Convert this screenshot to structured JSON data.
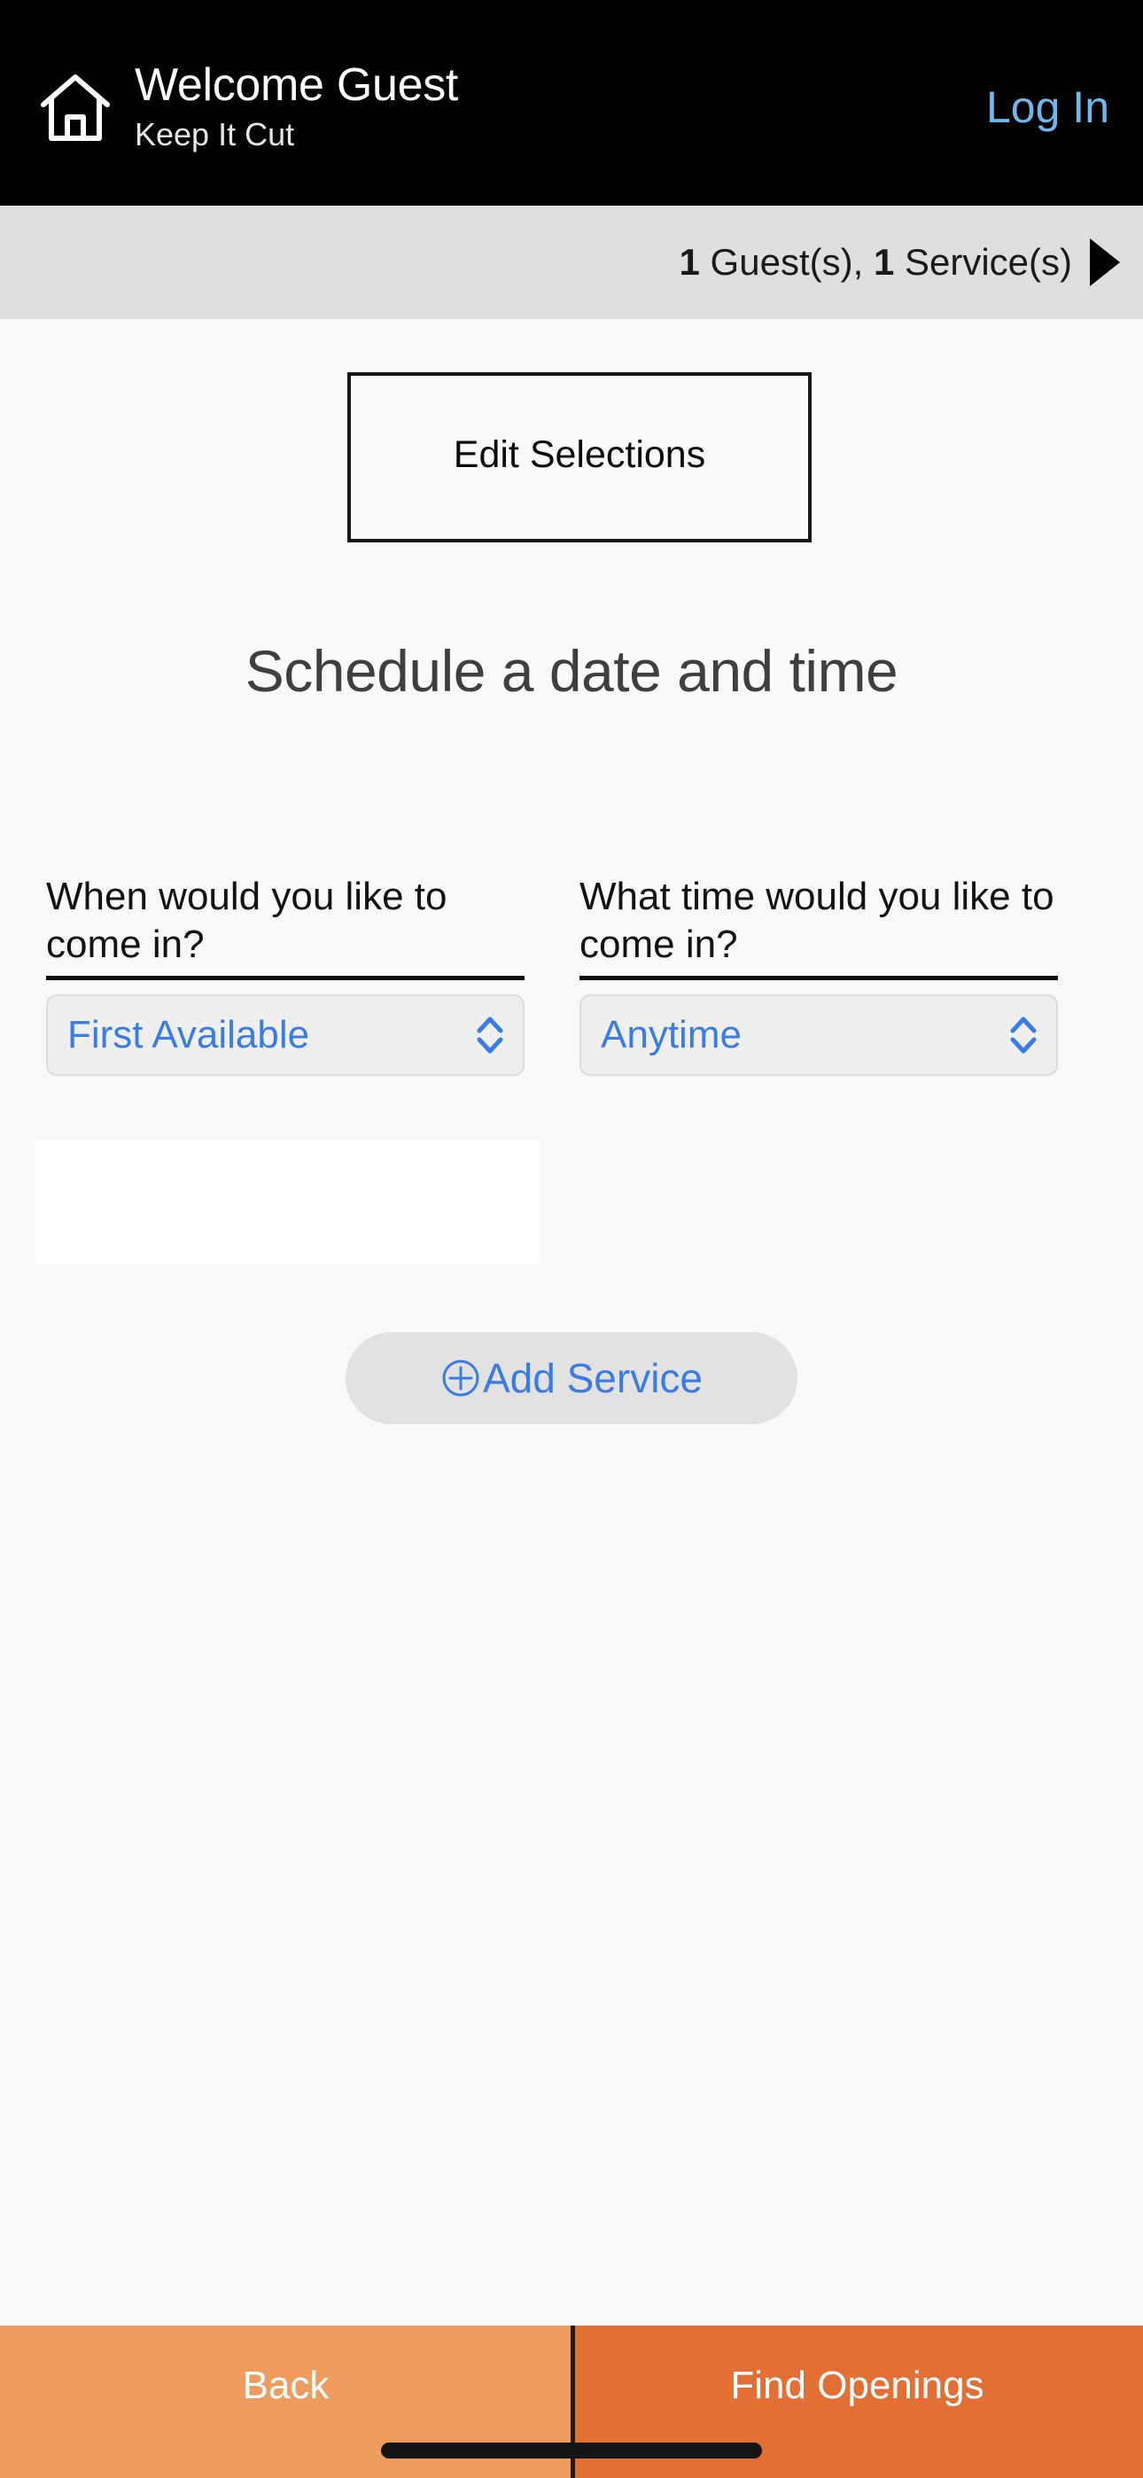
{
  "header": {
    "home_icon": "home-icon",
    "welcome_title": "Welcome Guest",
    "business_name": "Keep It Cut",
    "login_label": "Log In",
    "background_color": "#000000",
    "login_color": "#6cb9ed"
  },
  "summary_bar": {
    "guest_count": "1",
    "guest_label": " Guest(s), ",
    "service_count": "1",
    "service_label": " Service(s)",
    "arrow_icon": "triangle-right-icon",
    "background_color": "#dfdfdf"
  },
  "edit_selections": {
    "label": "Edit Selections"
  },
  "main": {
    "title": "Schedule a date and time",
    "fields": [
      {
        "label": "When would you like to come in?",
        "value": "First Available",
        "icon": "chevron-up-down-icon"
      },
      {
        "label": "What time would you like to come in?",
        "value": "Anytime",
        "icon": "chevron-up-down-icon"
      }
    ],
    "add_service": {
      "icon": "circle-plus-icon",
      "label": "Add Service"
    },
    "accent_color": "#3a7bea"
  },
  "bottom_bar": {
    "back_label": "Back",
    "find_label": "Find Openings",
    "back_color": "#ef9d5e",
    "find_color": "#e36f35"
  }
}
